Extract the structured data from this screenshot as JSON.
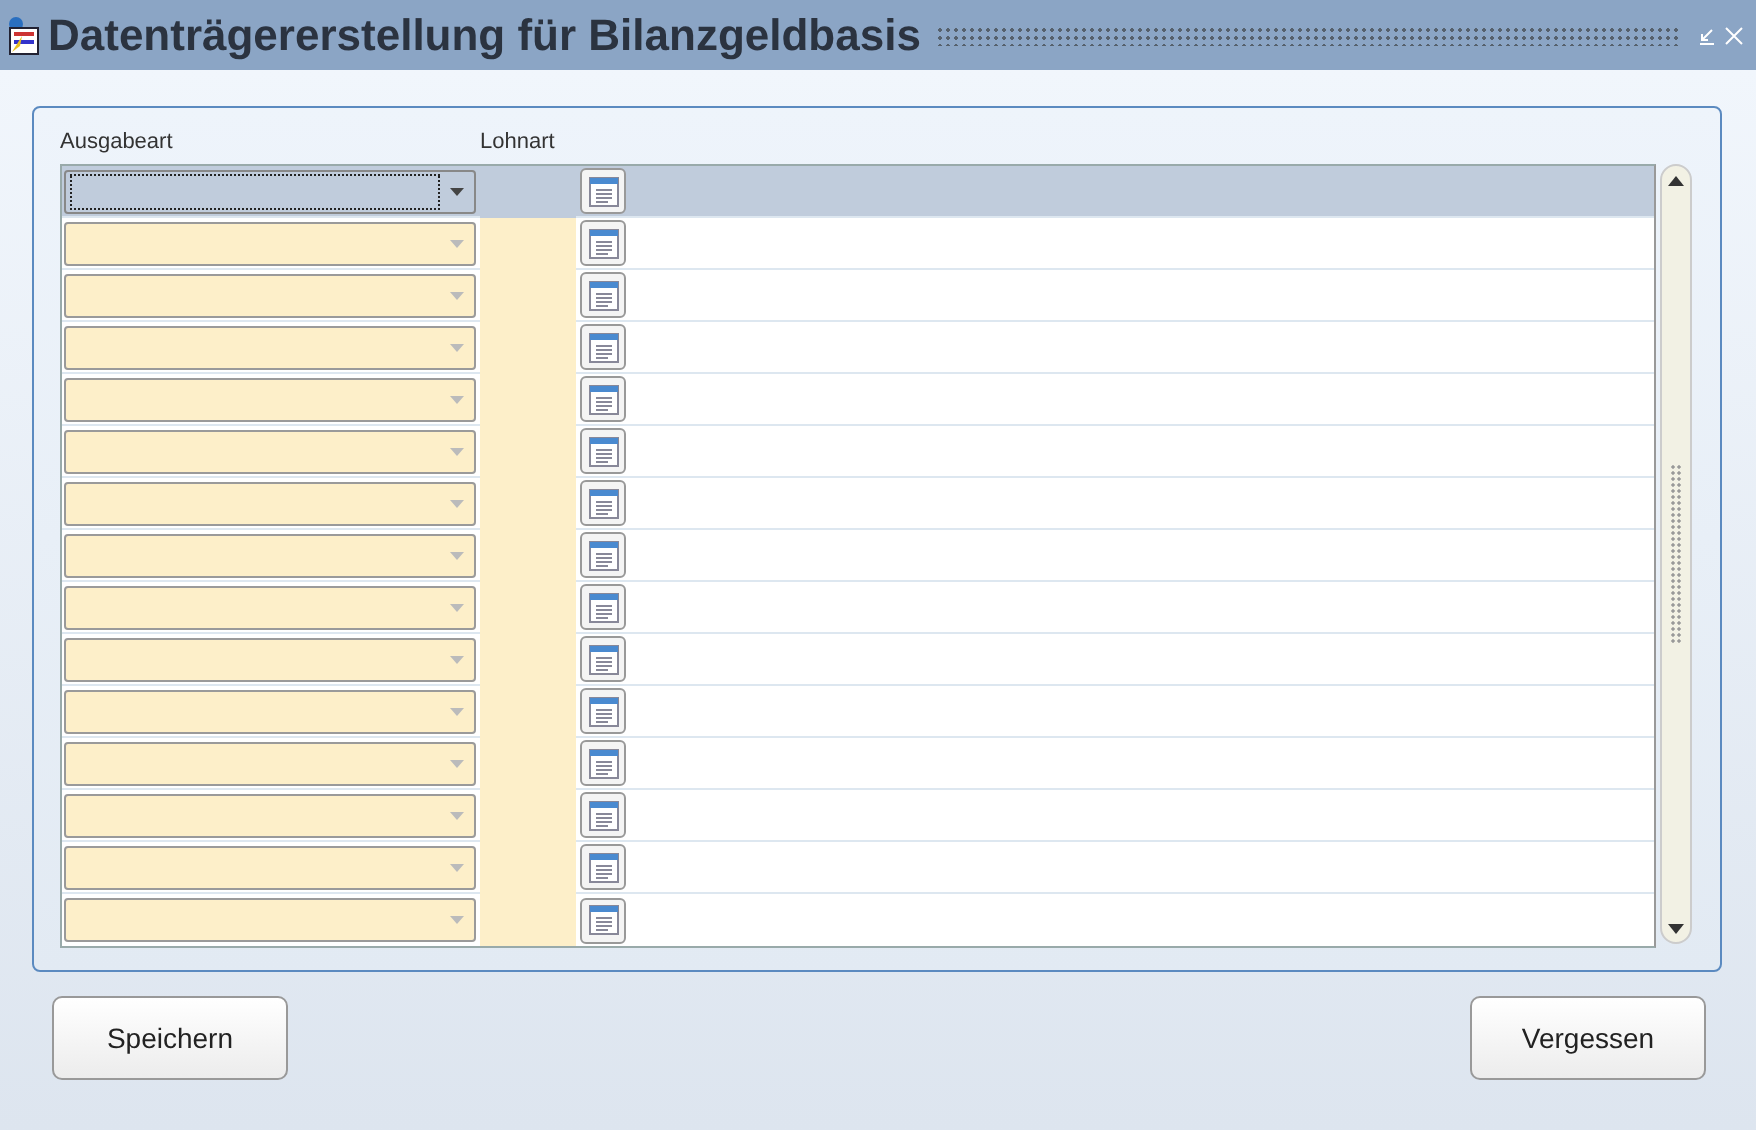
{
  "window": {
    "title": "Datenträgererstellung für Bilanzgeldbasis"
  },
  "table": {
    "columns": [
      "Ausgabeart",
      "Lohnart"
    ],
    "rows": [
      {
        "selected": true
      },
      {
        "selected": false
      },
      {
        "selected": false
      },
      {
        "selected": false
      },
      {
        "selected": false
      },
      {
        "selected": false
      },
      {
        "selected": false
      },
      {
        "selected": false
      },
      {
        "selected": false
      },
      {
        "selected": false
      },
      {
        "selected": false
      },
      {
        "selected": false
      },
      {
        "selected": false
      },
      {
        "selected": false
      },
      {
        "selected": false
      }
    ]
  },
  "buttons": [
    "Speichern",
    "Vergessen"
  ]
}
